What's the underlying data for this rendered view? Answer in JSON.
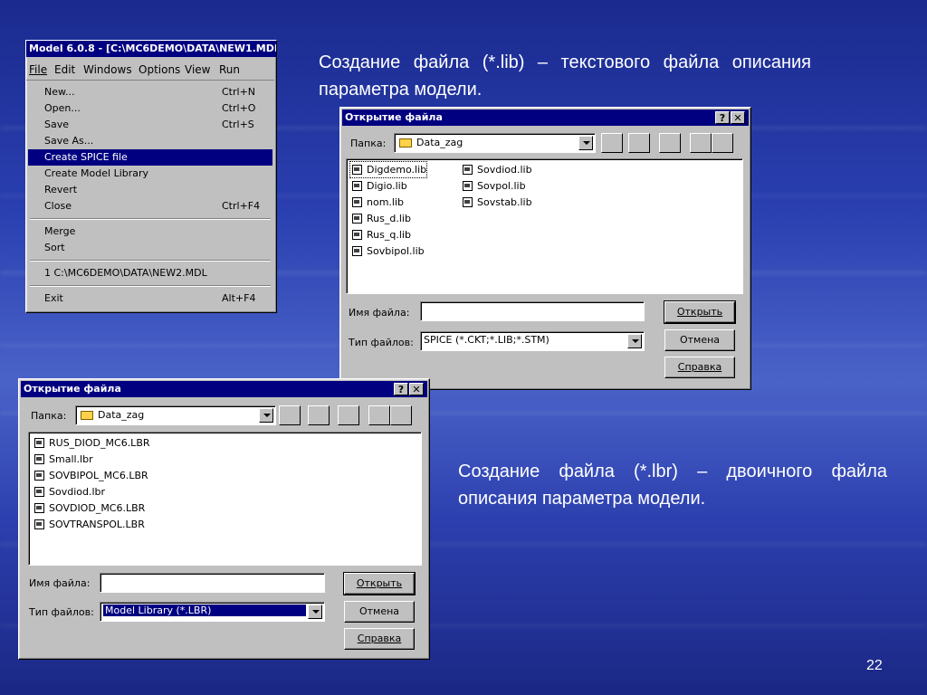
{
  "slide": {
    "text1": "Создание файла (*.lib) – текстового файла описания параметра модели.",
    "text2": "Создание файла (*.lbr) – двоичного файла описания параметра модели.",
    "page_number": "22"
  },
  "menu_window": {
    "title": "Model 6.0.8 - [C:\\MC6DEMO\\DATA\\NEW1.MDL",
    "menubar": [
      "File",
      "Edit",
      "Windows",
      "Options",
      "View",
      "Run"
    ],
    "items": [
      {
        "label": "New...",
        "shortcut": "Ctrl+N"
      },
      {
        "label": "Open...",
        "shortcut": "Ctrl+O"
      },
      {
        "label": "Save",
        "shortcut": "Ctrl+S"
      },
      {
        "label": "Save As...",
        "shortcut": ""
      },
      {
        "label": "Create SPICE file",
        "shortcut": ""
      },
      {
        "label": "Create Model Library",
        "shortcut": ""
      },
      {
        "label": "Revert",
        "shortcut": ""
      },
      {
        "label": "Close",
        "shortcut": "Ctrl+F4"
      },
      {
        "label": "Merge",
        "shortcut": ""
      },
      {
        "label": "Sort",
        "shortcut": ""
      },
      {
        "label": "1 C:\\MC6DEMO\\DATA\\NEW2.MDL",
        "shortcut": ""
      },
      {
        "label": "Exit",
        "shortcut": "Alt+F4"
      }
    ]
  },
  "dialog1": {
    "title": "Открытие файла",
    "help_btn": "?",
    "close_btn": "✕",
    "folder_label": "Папка:",
    "folder_value": "Data_zag",
    "files": [
      "Digdemo.lib",
      "Digio.lib",
      "nom.lib",
      "Rus_d.lib",
      "Rus_q.lib",
      "Sovbipol.lib",
      "Sovdiod.lib",
      "Sovpol.lib",
      "Sovstab.lib"
    ],
    "filename_label": "Имя файла:",
    "filename_value": "",
    "filetype_label": "Тип файлов:",
    "filetype_value": "SPICE (*.CKT;*.LIB;*.STM)",
    "open_btn": "Открыть",
    "cancel_btn": "Отмена",
    "help_button": "Справка"
  },
  "dialog2": {
    "title": "Открытие файла",
    "help_btn": "?",
    "close_btn": "✕",
    "folder_label": "Папка:",
    "folder_value": "Data_zag",
    "files": [
      "RUS_DIOD_MC6.LBR",
      "Small.lbr",
      "SOVBIPOL_MC6.LBR",
      "Sovdiod.lbr",
      "SOVDIOD_MC6.LBR",
      "SOVTRANSPOL.LBR"
    ],
    "filename_label": "Имя файла:",
    "filename_value": "",
    "filetype_label": "Тип файлов:",
    "filetype_value": "Model Library (*.LBR)",
    "open_btn": "Открыть",
    "cancel_btn": "Отмена",
    "help_button": "Справка"
  }
}
